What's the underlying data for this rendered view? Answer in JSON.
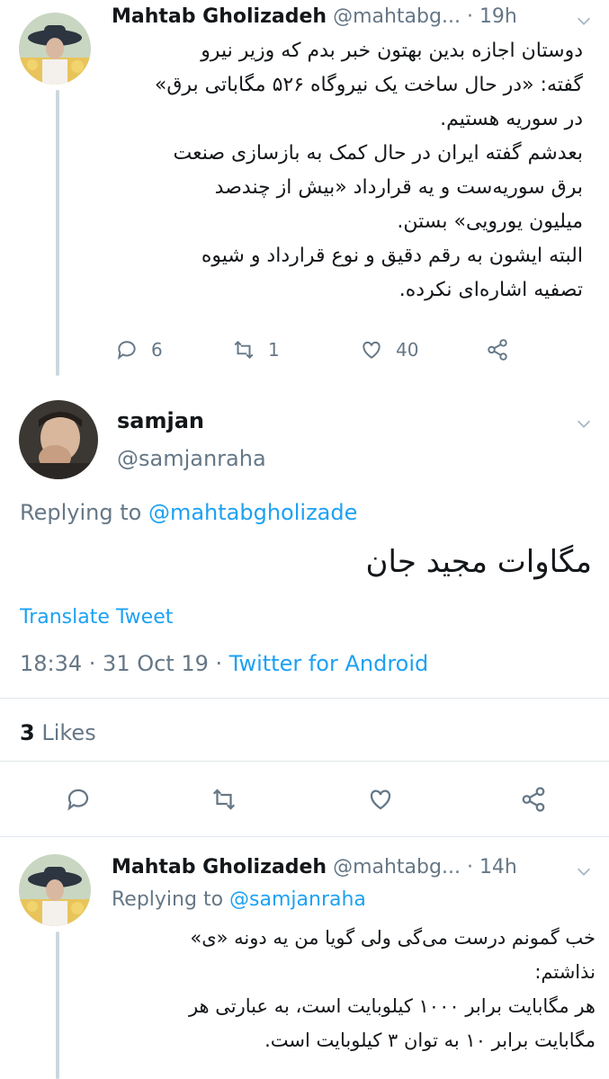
{
  "tweet1": {
    "name": "Mahtab Gholizadeh",
    "handle": "@mahtabg...",
    "time": "· 19h",
    "lines": [
      "دوستان اجازه بدین بهتون خبر بدم که وزیر نیرو",
      "گفته: «در حال ساخت یک نیروگاه ۵۲۶ مگاباتی برق»",
      "در سوریه هستیم.",
      "بعدشم گفته ایران در حال کمک به بازسازی صنعت",
      "برق سوریه‌ست و یه قرارداد «بیش از چندصد",
      "میلیون یورویی» بستن.",
      "البته ایشون به رقم دقیق و نوع قرارداد و شیوه",
      "تصفیه اشاره‌ای نکرده."
    ],
    "replies": "6",
    "retweets": "1",
    "likes": "40"
  },
  "tweet2": {
    "name": "samjan",
    "handle": "@samjanraha",
    "replying_label": "Replying to",
    "replying_handle": "@mahtabgholizade",
    "text": "مگاوات مجید جان",
    "translate": "Translate Tweet",
    "time_date": "18:34 · 31 Oct 19 ·",
    "source": "Twitter for Android",
    "likes_count": "3",
    "likes_label": "Likes"
  },
  "tweet3": {
    "name": "Mahtab Gholizadeh",
    "handle": "@mahtabg...",
    "time": "· 14h",
    "replying_label": "Replying to",
    "replying_handle": "@samjanraha",
    "lines": [
      "خب گمونم درست می‌گی ولی گویا من یه دونه «ی»",
      "نذاشتم:",
      "هر مگابایت برابر ۱۰۰۰ کیلوبایت است، به عبارتی هر",
      "مگابایت برابر ۱۰ به توان ۳ کیلوبایت است."
    ]
  },
  "colors": {
    "accent": "#1da1f2",
    "muted": "#657786",
    "line": "#ccd6dd"
  },
  "icons": [
    "reply-icon",
    "retweet-icon",
    "like-icon",
    "share-icon",
    "chevron-down-icon"
  ]
}
